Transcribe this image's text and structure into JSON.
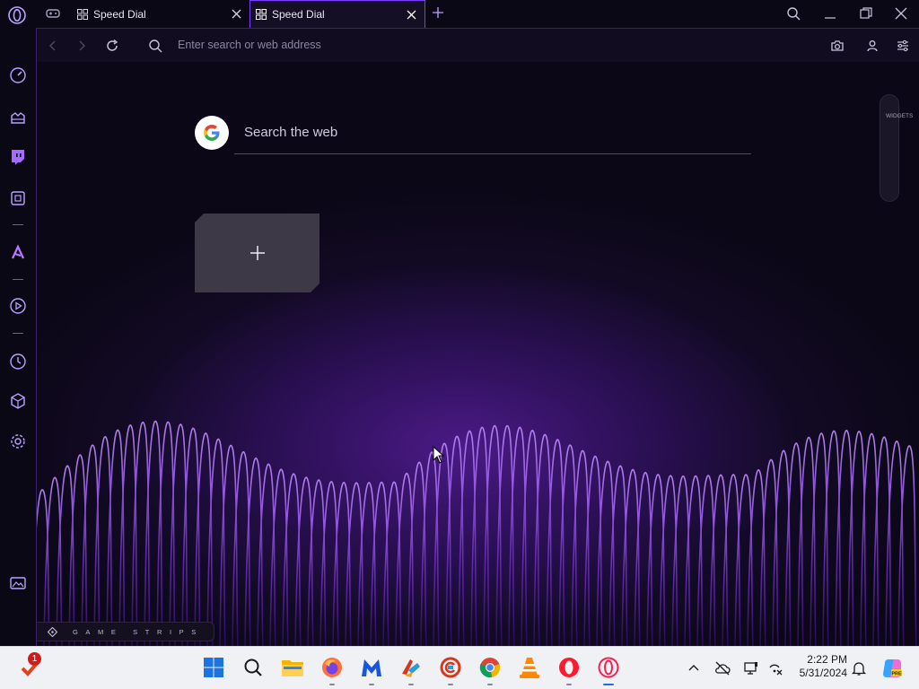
{
  "browser": {
    "tabs": [
      {
        "label": "Speed Dial",
        "active": false,
        "icon": "speed-dial-icon"
      },
      {
        "label": "Speed Dial",
        "active": true,
        "icon": "speed-dial-icon"
      }
    ],
    "address_bar": {
      "placeholder": "Enter search or web address"
    },
    "accent_color": "#7a3cff"
  },
  "speed_dial": {
    "search_placeholder": "Search the web",
    "search_engine_icon": "google-g-icon",
    "add_tile_icon": "plus-icon"
  },
  "widgets": {
    "label": "WIDGETS"
  },
  "game_strips": {
    "label": "GAME STRIPS"
  },
  "sidebar": {
    "items": [
      "speed-dial-icon",
      "gx-corner-icon",
      "twitch-icon",
      "gx-control-icon",
      "aria-icon",
      "player-icon",
      "history-icon",
      "extensions-icon",
      "settings-icon",
      "wallpaper-icon",
      "more-icon"
    ]
  },
  "taskbar": {
    "apps": [
      "windows-start-icon",
      "search-icon",
      "file-explorer-icon",
      "firefox-icon",
      "malwarebytes-icon",
      "ccleaner-icon",
      "tool-icon",
      "chrome-icon",
      "vlc-icon",
      "opera-icon",
      "opera-gx-icon"
    ],
    "notification_badge": "1",
    "time": "2:22 PM",
    "date": "5/31/2024"
  }
}
